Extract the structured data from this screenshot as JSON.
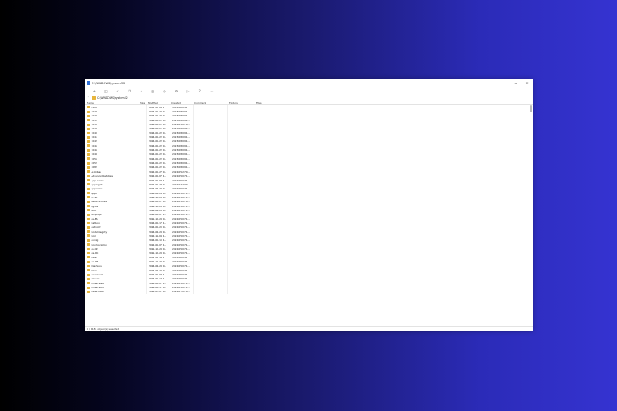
{
  "window": {
    "title": "C:\\WINDOWS\\system32",
    "minimize": "–",
    "maximize": "▫",
    "close": "✕"
  },
  "toolbar": [
    {
      "icon": "plus-icon",
      "glyph": "+"
    },
    {
      "icon": "new-folder-icon",
      "glyph": "◫"
    },
    {
      "icon": "checkmark-icon",
      "glyph": "✓"
    },
    {
      "icon": "copy-icon",
      "glyph": "❐"
    },
    {
      "icon": "user-icon",
      "glyph": "♟"
    },
    {
      "icon": "trash-icon",
      "glyph": "▥"
    },
    {
      "icon": "history-icon",
      "glyph": "◷"
    },
    {
      "icon": "settings-icon",
      "glyph": "⚙"
    },
    {
      "icon": "play-icon",
      "glyph": "▷"
    },
    {
      "icon": "help-icon",
      "glyph": "?"
    },
    {
      "icon": "more-icon",
      "glyph": "⋯"
    }
  ],
  "address": {
    "path": "C:\\WINDOWS\\system32"
  },
  "columns": {
    "name": "Name",
    "size": "Size",
    "modified": "Modified",
    "created": "Created",
    "comment": "Comment",
    "folders": "Folders",
    "files": "Files"
  },
  "rows": [
    {
      "name": "0409",
      "modified": "2022-05-07 1...",
      "created": "2022-05-07 1..."
    },
    {
      "name": "1028",
      "modified": "2024-05-22 0...",
      "created": "2023-08-09 1..."
    },
    {
      "name": "1029",
      "modified": "2024-05-22 0...",
      "created": "2023-08-09 1..."
    },
    {
      "name": "1031",
      "modified": "2024-05-22 0...",
      "created": "2023-08-09 1..."
    },
    {
      "name": "1033",
      "modified": "2024-05-22 0...",
      "created": "2022-05-07 0..."
    },
    {
      "name": "1036",
      "modified": "2024-05-22 0...",
      "created": "2023-08-09 1..."
    },
    {
      "name": "1040",
      "modified": "2024-05-22 0...",
      "created": "2023-08-09 1..."
    },
    {
      "name": "1041",
      "modified": "2024-05-22 0...",
      "created": "2023-08-09 1..."
    },
    {
      "name": "1042",
      "modified": "2024-05-22 0...",
      "created": "2023-08-09 1..."
    },
    {
      "name": "1045",
      "modified": "2024-05-22 0...",
      "created": "2023-08-09 1..."
    },
    {
      "name": "1046",
      "modified": "2024-05-22 0...",
      "created": "2023-08-09 1..."
    },
    {
      "name": "1049",
      "modified": "2024-05-22 0...",
      "created": "2023-08-09 1..."
    },
    {
      "name": "1055",
      "modified": "2024-05-22 0...",
      "created": "2023-08-09 1..."
    },
    {
      "name": "2052",
      "modified": "2024-05-22 0...",
      "created": "2023-08-09 1..."
    },
    {
      "name": "3082",
      "modified": "2024-05-22 0...",
      "created": "2023-08-09 1..."
    },
    {
      "name": "AI-Ikibas",
      "modified": "2022-05-27 0...",
      "created": "2022-05-27 0..."
    },
    {
      "name": "AdvancedInstallers",
      "modified": "2022-05-07 1...",
      "created": "2022-05-07 1..."
    },
    {
      "name": "AppLocker",
      "modified": "2022-05-07 1...",
      "created": "2022-05-07 1..."
    },
    {
      "name": "appmgmt",
      "modified": "2022-05-27 0...",
      "created": "2022-04-23 0..."
    },
    {
      "name": "appraiser",
      "modified": "2024-04-29 0...",
      "created": "2022-05-07 1..."
    },
    {
      "name": "AppV",
      "modified": "2024-01-24 0...",
      "created": "2022-05-07 1..."
    },
    {
      "name": "ar-SA",
      "modified": "2021-10-29 0...",
      "created": "2022-05-07 1..."
    },
    {
      "name": "BestPractices",
      "modified": "2022-05-27 0...",
      "created": "2022-05-07 0..."
    },
    {
      "name": "bg-BG",
      "modified": "2021-10-29 0...",
      "created": "2022-05-07 1..."
    },
    {
      "name": "Boot",
      "modified": "2024-04-29 0...",
      "created": "2022-05-07 1..."
    },
    {
      "name": "Bthprops",
      "modified": "2022-05-07 1...",
      "created": "2022-05-07 1..."
    },
    {
      "name": "ca-ES",
      "modified": "2021-10-29 0...",
      "created": "2022-05-07 1..."
    },
    {
      "name": "CatRoot",
      "modified": "2024-05-17 1...",
      "created": "2022-05-07 1..."
    },
    {
      "name": "catroot2",
      "modified": "2024-05-20 0...",
      "created": "2022-05-07 1..."
    },
    {
      "name": "CodeIntegrity",
      "modified": "2024-04-29 0...",
      "created": "2022-05-07 1..."
    },
    {
      "name": "Com",
      "modified": "2022-11-04 1...",
      "created": "2022-05-07 1..."
    },
    {
      "name": "config",
      "modified": "2024-05-10 1...",
      "created": "2022-05-07 1..."
    },
    {
      "name": "Configuration",
      "modified": "2022-05-07 1...",
      "created": "2022-05-07 1..."
    },
    {
      "name": "cs-CZ",
      "modified": "2021-10-29 0...",
      "created": "2022-05-07 1..."
    },
    {
      "name": "da-DK",
      "modified": "2021-10-29 0...",
      "created": "2022-05-07 1..."
    },
    {
      "name": "DDFs",
      "modified": "2024-02-27 1...",
      "created": "2022-05-07 1..."
    },
    {
      "name": "de-DE",
      "modified": "2021-10-29 0...",
      "created": "2022-05-07 1..."
    },
    {
      "name": "DiagSvcs",
      "modified": "2024-04-29 0...",
      "created": "2022-05-07 1..."
    },
    {
      "name": "Dism",
      "modified": "2024-04-29 0...",
      "created": "2022-05-07 1..."
    },
    {
      "name": "downlevel",
      "modified": "2022-05-07 1...",
      "created": "2022-05-07 1..."
    },
    {
      "name": "drivers",
      "modified": "2024-05-17 1...",
      "created": "2022-05-07 1..."
    },
    {
      "name": "DriverState",
      "modified": "2022-05-07 1...",
      "created": "2022-05-07 1..."
    },
    {
      "name": "DriverStore",
      "modified": "2024-05-17 0...",
      "created": "2022-05-07 1..."
    },
    {
      "name": "DRVSTORE",
      "modified": "2022-07-07 0...",
      "created": "2022-07-07 0..."
    }
  ],
  "status": "0 / 1181 object(s) selected"
}
